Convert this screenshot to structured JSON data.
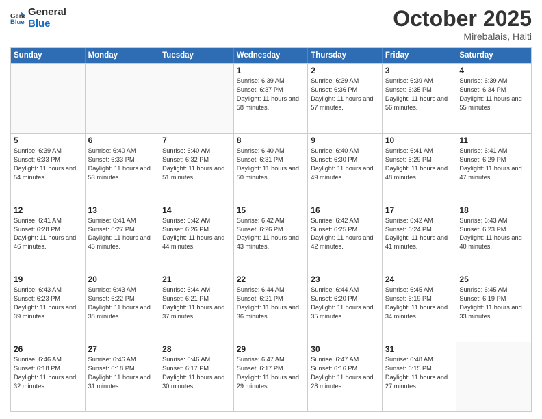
{
  "header": {
    "logo_general": "General",
    "logo_blue": "Blue",
    "month_title": "October 2025",
    "location": "Mirebalais, Haiti"
  },
  "weekdays": [
    "Sunday",
    "Monday",
    "Tuesday",
    "Wednesday",
    "Thursday",
    "Friday",
    "Saturday"
  ],
  "weeks": [
    [
      {
        "day": "",
        "sunrise": "",
        "sunset": "",
        "daylight": "",
        "empty": true
      },
      {
        "day": "",
        "sunrise": "",
        "sunset": "",
        "daylight": "",
        "empty": true
      },
      {
        "day": "",
        "sunrise": "",
        "sunset": "",
        "daylight": "",
        "empty": true
      },
      {
        "day": "1",
        "sunrise": "Sunrise: 6:39 AM",
        "sunset": "Sunset: 6:37 PM",
        "daylight": "Daylight: 11 hours and 58 minutes.",
        "empty": false
      },
      {
        "day": "2",
        "sunrise": "Sunrise: 6:39 AM",
        "sunset": "Sunset: 6:36 PM",
        "daylight": "Daylight: 11 hours and 57 minutes.",
        "empty": false
      },
      {
        "day": "3",
        "sunrise": "Sunrise: 6:39 AM",
        "sunset": "Sunset: 6:35 PM",
        "daylight": "Daylight: 11 hours and 56 minutes.",
        "empty": false
      },
      {
        "day": "4",
        "sunrise": "Sunrise: 6:39 AM",
        "sunset": "Sunset: 6:34 PM",
        "daylight": "Daylight: 11 hours and 55 minutes.",
        "empty": false
      }
    ],
    [
      {
        "day": "5",
        "sunrise": "Sunrise: 6:39 AM",
        "sunset": "Sunset: 6:33 PM",
        "daylight": "Daylight: 11 hours and 54 minutes.",
        "empty": false
      },
      {
        "day": "6",
        "sunrise": "Sunrise: 6:40 AM",
        "sunset": "Sunset: 6:33 PM",
        "daylight": "Daylight: 11 hours and 53 minutes.",
        "empty": false
      },
      {
        "day": "7",
        "sunrise": "Sunrise: 6:40 AM",
        "sunset": "Sunset: 6:32 PM",
        "daylight": "Daylight: 11 hours and 51 minutes.",
        "empty": false
      },
      {
        "day": "8",
        "sunrise": "Sunrise: 6:40 AM",
        "sunset": "Sunset: 6:31 PM",
        "daylight": "Daylight: 11 hours and 50 minutes.",
        "empty": false
      },
      {
        "day": "9",
        "sunrise": "Sunrise: 6:40 AM",
        "sunset": "Sunset: 6:30 PM",
        "daylight": "Daylight: 11 hours and 49 minutes.",
        "empty": false
      },
      {
        "day": "10",
        "sunrise": "Sunrise: 6:41 AM",
        "sunset": "Sunset: 6:29 PM",
        "daylight": "Daylight: 11 hours and 48 minutes.",
        "empty": false
      },
      {
        "day": "11",
        "sunrise": "Sunrise: 6:41 AM",
        "sunset": "Sunset: 6:29 PM",
        "daylight": "Daylight: 11 hours and 47 minutes.",
        "empty": false
      }
    ],
    [
      {
        "day": "12",
        "sunrise": "Sunrise: 6:41 AM",
        "sunset": "Sunset: 6:28 PM",
        "daylight": "Daylight: 11 hours and 46 minutes.",
        "empty": false
      },
      {
        "day": "13",
        "sunrise": "Sunrise: 6:41 AM",
        "sunset": "Sunset: 6:27 PM",
        "daylight": "Daylight: 11 hours and 45 minutes.",
        "empty": false
      },
      {
        "day": "14",
        "sunrise": "Sunrise: 6:42 AM",
        "sunset": "Sunset: 6:26 PM",
        "daylight": "Daylight: 11 hours and 44 minutes.",
        "empty": false
      },
      {
        "day": "15",
        "sunrise": "Sunrise: 6:42 AM",
        "sunset": "Sunset: 6:26 PM",
        "daylight": "Daylight: 11 hours and 43 minutes.",
        "empty": false
      },
      {
        "day": "16",
        "sunrise": "Sunrise: 6:42 AM",
        "sunset": "Sunset: 6:25 PM",
        "daylight": "Daylight: 11 hours and 42 minutes.",
        "empty": false
      },
      {
        "day": "17",
        "sunrise": "Sunrise: 6:42 AM",
        "sunset": "Sunset: 6:24 PM",
        "daylight": "Daylight: 11 hours and 41 minutes.",
        "empty": false
      },
      {
        "day": "18",
        "sunrise": "Sunrise: 6:43 AM",
        "sunset": "Sunset: 6:23 PM",
        "daylight": "Daylight: 11 hours and 40 minutes.",
        "empty": false
      }
    ],
    [
      {
        "day": "19",
        "sunrise": "Sunrise: 6:43 AM",
        "sunset": "Sunset: 6:23 PM",
        "daylight": "Daylight: 11 hours and 39 minutes.",
        "empty": false
      },
      {
        "day": "20",
        "sunrise": "Sunrise: 6:43 AM",
        "sunset": "Sunset: 6:22 PM",
        "daylight": "Daylight: 11 hours and 38 minutes.",
        "empty": false
      },
      {
        "day": "21",
        "sunrise": "Sunrise: 6:44 AM",
        "sunset": "Sunset: 6:21 PM",
        "daylight": "Daylight: 11 hours and 37 minutes.",
        "empty": false
      },
      {
        "day": "22",
        "sunrise": "Sunrise: 6:44 AM",
        "sunset": "Sunset: 6:21 PM",
        "daylight": "Daylight: 11 hours and 36 minutes.",
        "empty": false
      },
      {
        "day": "23",
        "sunrise": "Sunrise: 6:44 AM",
        "sunset": "Sunset: 6:20 PM",
        "daylight": "Daylight: 11 hours and 35 minutes.",
        "empty": false
      },
      {
        "day": "24",
        "sunrise": "Sunrise: 6:45 AM",
        "sunset": "Sunset: 6:19 PM",
        "daylight": "Daylight: 11 hours and 34 minutes.",
        "empty": false
      },
      {
        "day": "25",
        "sunrise": "Sunrise: 6:45 AM",
        "sunset": "Sunset: 6:19 PM",
        "daylight": "Daylight: 11 hours and 33 minutes.",
        "empty": false
      }
    ],
    [
      {
        "day": "26",
        "sunrise": "Sunrise: 6:46 AM",
        "sunset": "Sunset: 6:18 PM",
        "daylight": "Daylight: 11 hours and 32 minutes.",
        "empty": false
      },
      {
        "day": "27",
        "sunrise": "Sunrise: 6:46 AM",
        "sunset": "Sunset: 6:18 PM",
        "daylight": "Daylight: 11 hours and 31 minutes.",
        "empty": false
      },
      {
        "day": "28",
        "sunrise": "Sunrise: 6:46 AM",
        "sunset": "Sunset: 6:17 PM",
        "daylight": "Daylight: 11 hours and 30 minutes.",
        "empty": false
      },
      {
        "day": "29",
        "sunrise": "Sunrise: 6:47 AM",
        "sunset": "Sunset: 6:17 PM",
        "daylight": "Daylight: 11 hours and 29 minutes.",
        "empty": false
      },
      {
        "day": "30",
        "sunrise": "Sunrise: 6:47 AM",
        "sunset": "Sunset: 6:16 PM",
        "daylight": "Daylight: 11 hours and 28 minutes.",
        "empty": false
      },
      {
        "day": "31",
        "sunrise": "Sunrise: 6:48 AM",
        "sunset": "Sunset: 6:15 PM",
        "daylight": "Daylight: 11 hours and 27 minutes.",
        "empty": false
      },
      {
        "day": "",
        "sunrise": "",
        "sunset": "",
        "daylight": "",
        "empty": true
      }
    ]
  ]
}
